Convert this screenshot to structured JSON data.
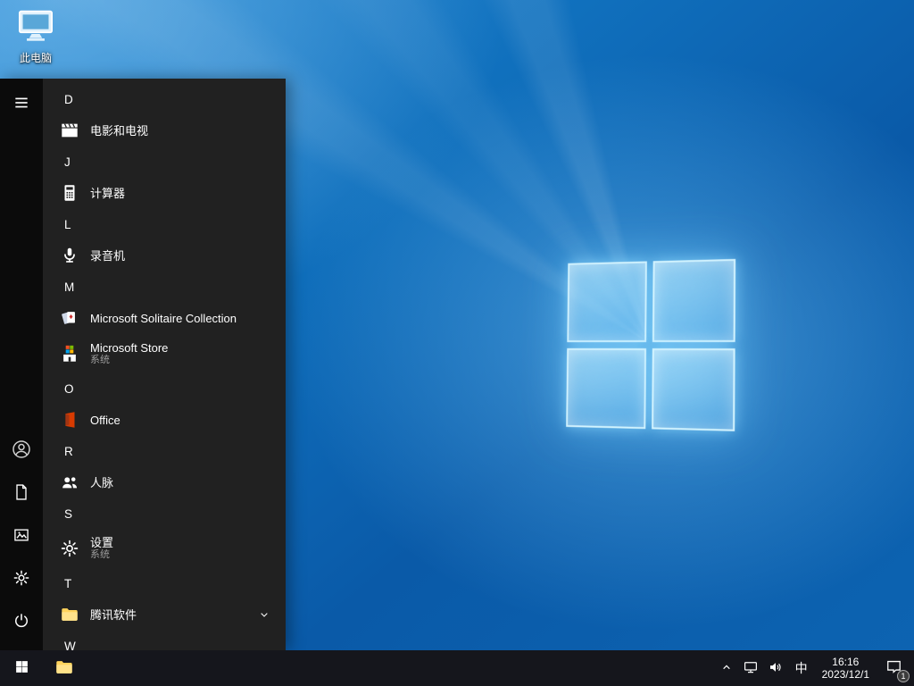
{
  "colors": {
    "accent_blue": "#0078d7",
    "wallpaper_base": "#0d64b2",
    "logo_glow": "#8fd8ff",
    "office_orange": "#d83b01",
    "office_orange_dark": "#a33512",
    "folder_yellow": "#ffd35c",
    "folder_yellow_light": "#ffe28a",
    "store_red": "#f25022",
    "store_green": "#7fba00",
    "store_blue": "#00a4ef",
    "store_yellow": "#ffb900"
  },
  "desktop": {
    "this_pc_label": "此电脑"
  },
  "start_menu": {
    "rail_icons": [
      "hamburger",
      "user",
      "document",
      "pictures",
      "gear",
      "power"
    ],
    "sections": [
      {
        "letter": "D",
        "apps": [
          {
            "name": "电影和电视",
            "icon": "movies-tv"
          }
        ]
      },
      {
        "letter": "J",
        "apps": [
          {
            "name": "计算器",
            "icon": "calculator"
          }
        ]
      },
      {
        "letter": "L",
        "apps": [
          {
            "name": "录音机",
            "icon": "voice-recorder"
          }
        ]
      },
      {
        "letter": "M",
        "apps": [
          {
            "name": "Microsoft Solitaire Collection",
            "icon": "solitaire-cards"
          },
          {
            "name": "Microsoft Store",
            "subtitle": "系统",
            "icon": "store"
          }
        ]
      },
      {
        "letter": "O",
        "apps": [
          {
            "name": "Office",
            "icon": "office"
          }
        ]
      },
      {
        "letter": "R",
        "apps": [
          {
            "name": "人脉",
            "icon": "people"
          }
        ]
      },
      {
        "letter": "S",
        "apps": [
          {
            "name": "设置",
            "subtitle": "系统",
            "icon": "gear"
          }
        ]
      },
      {
        "letter": "T",
        "apps": [
          {
            "name": "腾讯软件",
            "icon": "folder",
            "expandable": true
          }
        ]
      },
      {
        "letter": "W",
        "apps": []
      }
    ]
  },
  "taskbar": {
    "tray": {
      "ime": "中",
      "time": "16:16",
      "date": "2023/12/1",
      "notification_badge": "1"
    }
  }
}
